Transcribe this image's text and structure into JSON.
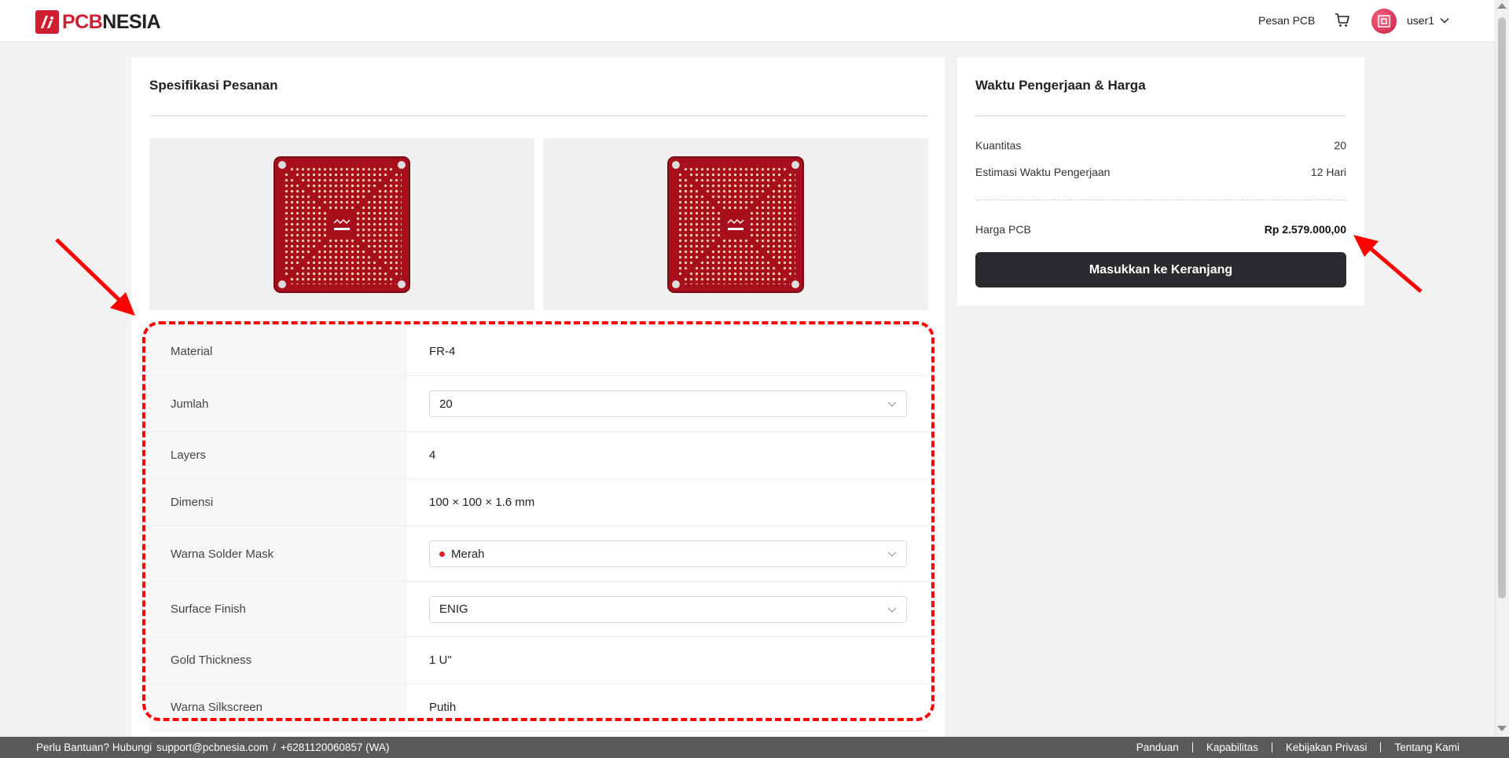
{
  "header": {
    "logo_pcb": "PCB",
    "logo_nesia": "NESIA",
    "nav_order": "Pesan PCB",
    "user_name": "user1"
  },
  "order_spec": {
    "title": "Spesifikasi Pesanan",
    "rows": [
      {
        "label": "Material",
        "value": "FR-4",
        "type": "text"
      },
      {
        "label": "Jumlah",
        "value": "20",
        "type": "select"
      },
      {
        "label": "Layers",
        "value": "4",
        "type": "text"
      },
      {
        "label": "Dimensi",
        "value": "100 × 100 × 1.6 mm",
        "type": "text"
      },
      {
        "label": "Warna Solder Mask",
        "value": "Merah",
        "type": "select-color"
      },
      {
        "label": "Surface Finish",
        "value": "ENIG",
        "type": "select"
      },
      {
        "label": "Gold Thickness",
        "value": "1 U\"",
        "type": "text"
      },
      {
        "label": "Warna Silkscreen",
        "value": "Putih",
        "type": "text"
      }
    ]
  },
  "pricing": {
    "title": "Waktu Pengerjaan & Harga",
    "quantity_label": "Kuantitas",
    "quantity_value": "20",
    "lead_time_label": "Estimasi Waktu Pengerjaan",
    "lead_time_value": "12 Hari",
    "price_label": "Harga PCB",
    "price_value": "Rp 2.579.000,00",
    "add_to_cart": "Masukkan ke Keranjang"
  },
  "footer": {
    "help_text": "Perlu Bantuan? Hubungi",
    "email": "support@pcbnesia.com",
    "separator": "/",
    "phone": "+6281120060857 (WA)",
    "links": [
      "Panduan",
      "Kapabilitas",
      "Kebijakan Privasi",
      "Tentang Kami"
    ]
  },
  "colors": {
    "brand_red": "#d01f2f",
    "button_dark": "#2a2b2e",
    "solder_mask": "#b01020",
    "annotation_red": "#ff0000"
  }
}
